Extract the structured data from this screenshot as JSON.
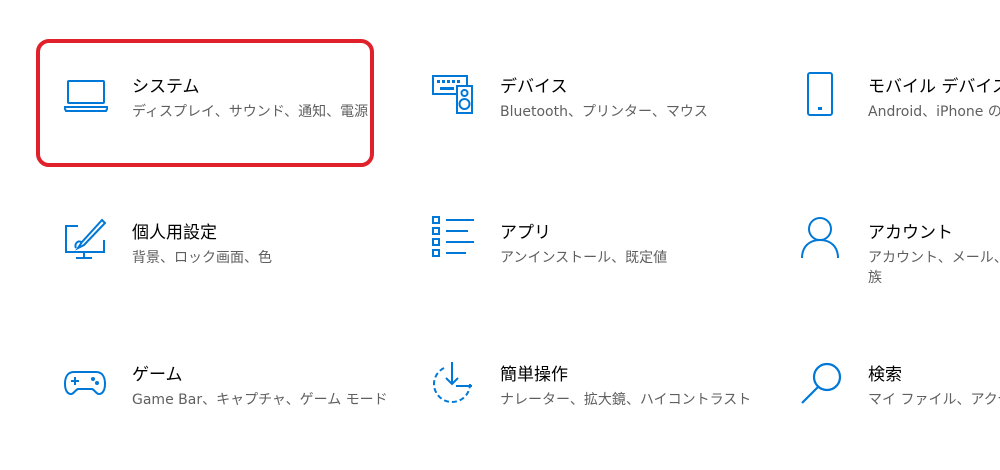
{
  "accent_color": "#0078d7",
  "highlight_color": "#e0212b",
  "tiles": [
    {
      "title": "システム",
      "desc": "ディスプレイ、サウンド、通知、電源",
      "icon": "laptop-icon"
    },
    {
      "title": "デバイス",
      "desc": "Bluetooth、プリンター、マウス",
      "icon": "keyboard-speaker-icon"
    },
    {
      "title": "モバイル デバイス",
      "desc": "Android、iPhone の",
      "icon": "phone-icon"
    },
    {
      "title": "個人用設定",
      "desc": "背景、ロック画面、色",
      "icon": "paintbrush-monitor-icon"
    },
    {
      "title": "アプリ",
      "desc": "アンインストール、既定値",
      "icon": "app-list-icon"
    },
    {
      "title": "アカウント",
      "desc": "アカウント、メール、同",
      "desc2": "族",
      "icon": "person-icon"
    },
    {
      "title": "ゲーム",
      "desc": "Game Bar、キャプチャ、ゲーム モード",
      "icon": "gamepad-icon"
    },
    {
      "title": "簡単操作",
      "desc": "ナレーター、拡大鏡、ハイコントラスト",
      "icon": "ease-of-access-icon"
    },
    {
      "title": "検索",
      "desc": "マイ ファイル、アクセス",
      "icon": "search-icon"
    }
  ]
}
